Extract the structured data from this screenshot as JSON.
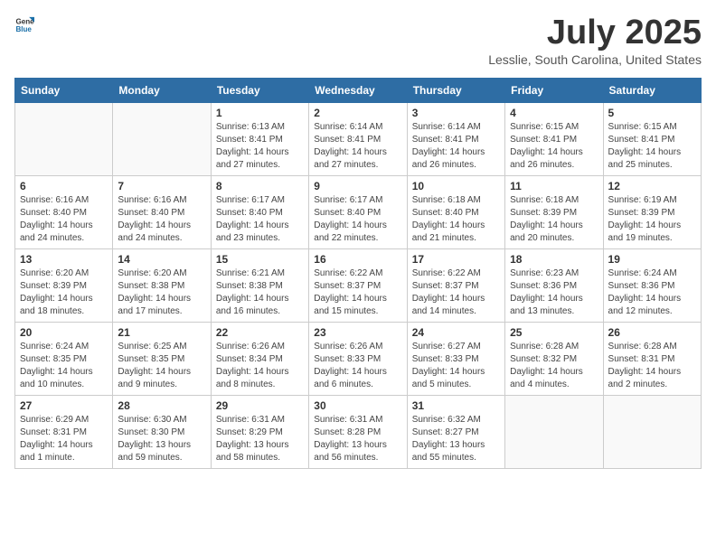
{
  "header": {
    "logo_general": "General",
    "logo_blue": "Blue",
    "title": "July 2025",
    "subtitle": "Lesslie, South Carolina, United States"
  },
  "weekdays": [
    "Sunday",
    "Monday",
    "Tuesday",
    "Wednesday",
    "Thursday",
    "Friday",
    "Saturday"
  ],
  "weeks": [
    [
      {
        "day": "",
        "detail": ""
      },
      {
        "day": "",
        "detail": ""
      },
      {
        "day": "1",
        "detail": "Sunrise: 6:13 AM\nSunset: 8:41 PM\nDaylight: 14 hours and 27 minutes."
      },
      {
        "day": "2",
        "detail": "Sunrise: 6:14 AM\nSunset: 8:41 PM\nDaylight: 14 hours and 27 minutes."
      },
      {
        "day": "3",
        "detail": "Sunrise: 6:14 AM\nSunset: 8:41 PM\nDaylight: 14 hours and 26 minutes."
      },
      {
        "day": "4",
        "detail": "Sunrise: 6:15 AM\nSunset: 8:41 PM\nDaylight: 14 hours and 26 minutes."
      },
      {
        "day": "5",
        "detail": "Sunrise: 6:15 AM\nSunset: 8:41 PM\nDaylight: 14 hours and 25 minutes."
      }
    ],
    [
      {
        "day": "6",
        "detail": "Sunrise: 6:16 AM\nSunset: 8:40 PM\nDaylight: 14 hours and 24 minutes."
      },
      {
        "day": "7",
        "detail": "Sunrise: 6:16 AM\nSunset: 8:40 PM\nDaylight: 14 hours and 24 minutes."
      },
      {
        "day": "8",
        "detail": "Sunrise: 6:17 AM\nSunset: 8:40 PM\nDaylight: 14 hours and 23 minutes."
      },
      {
        "day": "9",
        "detail": "Sunrise: 6:17 AM\nSunset: 8:40 PM\nDaylight: 14 hours and 22 minutes."
      },
      {
        "day": "10",
        "detail": "Sunrise: 6:18 AM\nSunset: 8:40 PM\nDaylight: 14 hours and 21 minutes."
      },
      {
        "day": "11",
        "detail": "Sunrise: 6:18 AM\nSunset: 8:39 PM\nDaylight: 14 hours and 20 minutes."
      },
      {
        "day": "12",
        "detail": "Sunrise: 6:19 AM\nSunset: 8:39 PM\nDaylight: 14 hours and 19 minutes."
      }
    ],
    [
      {
        "day": "13",
        "detail": "Sunrise: 6:20 AM\nSunset: 8:39 PM\nDaylight: 14 hours and 18 minutes."
      },
      {
        "day": "14",
        "detail": "Sunrise: 6:20 AM\nSunset: 8:38 PM\nDaylight: 14 hours and 17 minutes."
      },
      {
        "day": "15",
        "detail": "Sunrise: 6:21 AM\nSunset: 8:38 PM\nDaylight: 14 hours and 16 minutes."
      },
      {
        "day": "16",
        "detail": "Sunrise: 6:22 AM\nSunset: 8:37 PM\nDaylight: 14 hours and 15 minutes."
      },
      {
        "day": "17",
        "detail": "Sunrise: 6:22 AM\nSunset: 8:37 PM\nDaylight: 14 hours and 14 minutes."
      },
      {
        "day": "18",
        "detail": "Sunrise: 6:23 AM\nSunset: 8:36 PM\nDaylight: 14 hours and 13 minutes."
      },
      {
        "day": "19",
        "detail": "Sunrise: 6:24 AM\nSunset: 8:36 PM\nDaylight: 14 hours and 12 minutes."
      }
    ],
    [
      {
        "day": "20",
        "detail": "Sunrise: 6:24 AM\nSunset: 8:35 PM\nDaylight: 14 hours and 10 minutes."
      },
      {
        "day": "21",
        "detail": "Sunrise: 6:25 AM\nSunset: 8:35 PM\nDaylight: 14 hours and 9 minutes."
      },
      {
        "day": "22",
        "detail": "Sunrise: 6:26 AM\nSunset: 8:34 PM\nDaylight: 14 hours and 8 minutes."
      },
      {
        "day": "23",
        "detail": "Sunrise: 6:26 AM\nSunset: 8:33 PM\nDaylight: 14 hours and 6 minutes."
      },
      {
        "day": "24",
        "detail": "Sunrise: 6:27 AM\nSunset: 8:33 PM\nDaylight: 14 hours and 5 minutes."
      },
      {
        "day": "25",
        "detail": "Sunrise: 6:28 AM\nSunset: 8:32 PM\nDaylight: 14 hours and 4 minutes."
      },
      {
        "day": "26",
        "detail": "Sunrise: 6:28 AM\nSunset: 8:31 PM\nDaylight: 14 hours and 2 minutes."
      }
    ],
    [
      {
        "day": "27",
        "detail": "Sunrise: 6:29 AM\nSunset: 8:31 PM\nDaylight: 14 hours and 1 minute."
      },
      {
        "day": "28",
        "detail": "Sunrise: 6:30 AM\nSunset: 8:30 PM\nDaylight: 13 hours and 59 minutes."
      },
      {
        "day": "29",
        "detail": "Sunrise: 6:31 AM\nSunset: 8:29 PM\nDaylight: 13 hours and 58 minutes."
      },
      {
        "day": "30",
        "detail": "Sunrise: 6:31 AM\nSunset: 8:28 PM\nDaylight: 13 hours and 56 minutes."
      },
      {
        "day": "31",
        "detail": "Sunrise: 6:32 AM\nSunset: 8:27 PM\nDaylight: 13 hours and 55 minutes."
      },
      {
        "day": "",
        "detail": ""
      },
      {
        "day": "",
        "detail": ""
      }
    ]
  ]
}
